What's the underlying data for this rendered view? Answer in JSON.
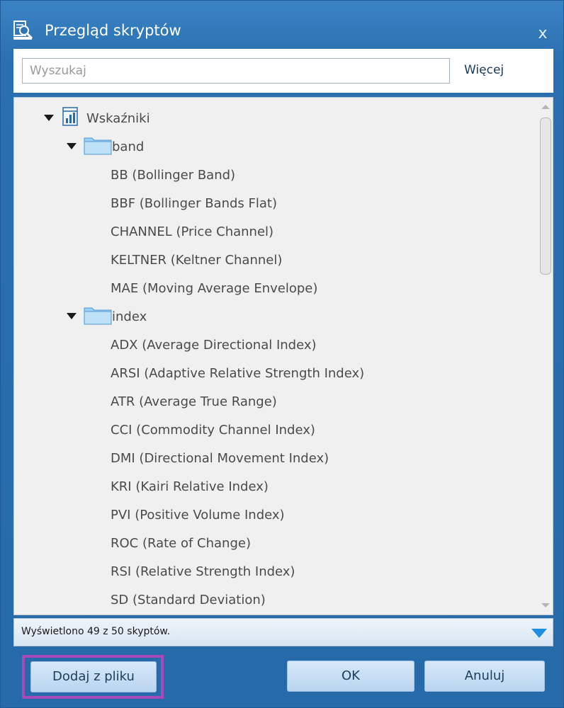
{
  "window": {
    "title": "Przegląd skryptów",
    "close_label": "x",
    "icon": "script-search-icon"
  },
  "search": {
    "placeholder": "Wyszukaj",
    "value": "",
    "more_label": "Więcej"
  },
  "tree": {
    "root_label": "Wskaźniki",
    "folders": [
      {
        "label": "band",
        "items": [
          "BB (Bollinger Band)",
          "BBF (Bollinger Bands Flat)",
          "CHANNEL (Price Channel)",
          "KELTNER (Keltner Channel)",
          "MAE (Moving Average Envelope)"
        ]
      },
      {
        "label": "index",
        "items": [
          "ADX (Average Directional Index)",
          "ARSI (Adaptive Relative Strength Index)",
          "ATR (Average True Range)",
          "CCI (Commodity Channel Index)",
          "DMI (Directional Movement Index)",
          "KRI (Kairi Relative Index)",
          "PVI (Positive Volume Index)",
          "ROC (Rate of Change)",
          "RSI (Relative Strength Index)",
          "SD (Standard Deviation)"
        ]
      }
    ]
  },
  "status": {
    "text": "Wyświetlono 49 z 50 skyptów."
  },
  "buttons": {
    "add_from_file": "Dodaj z pliku",
    "ok": "OK",
    "cancel": "Anuluj"
  },
  "colors": {
    "title_bar": "#2f74b5",
    "highlight": "#a74bb8",
    "status_arrow": "#1f8fe0",
    "tree_text": "#4a4a4a"
  }
}
